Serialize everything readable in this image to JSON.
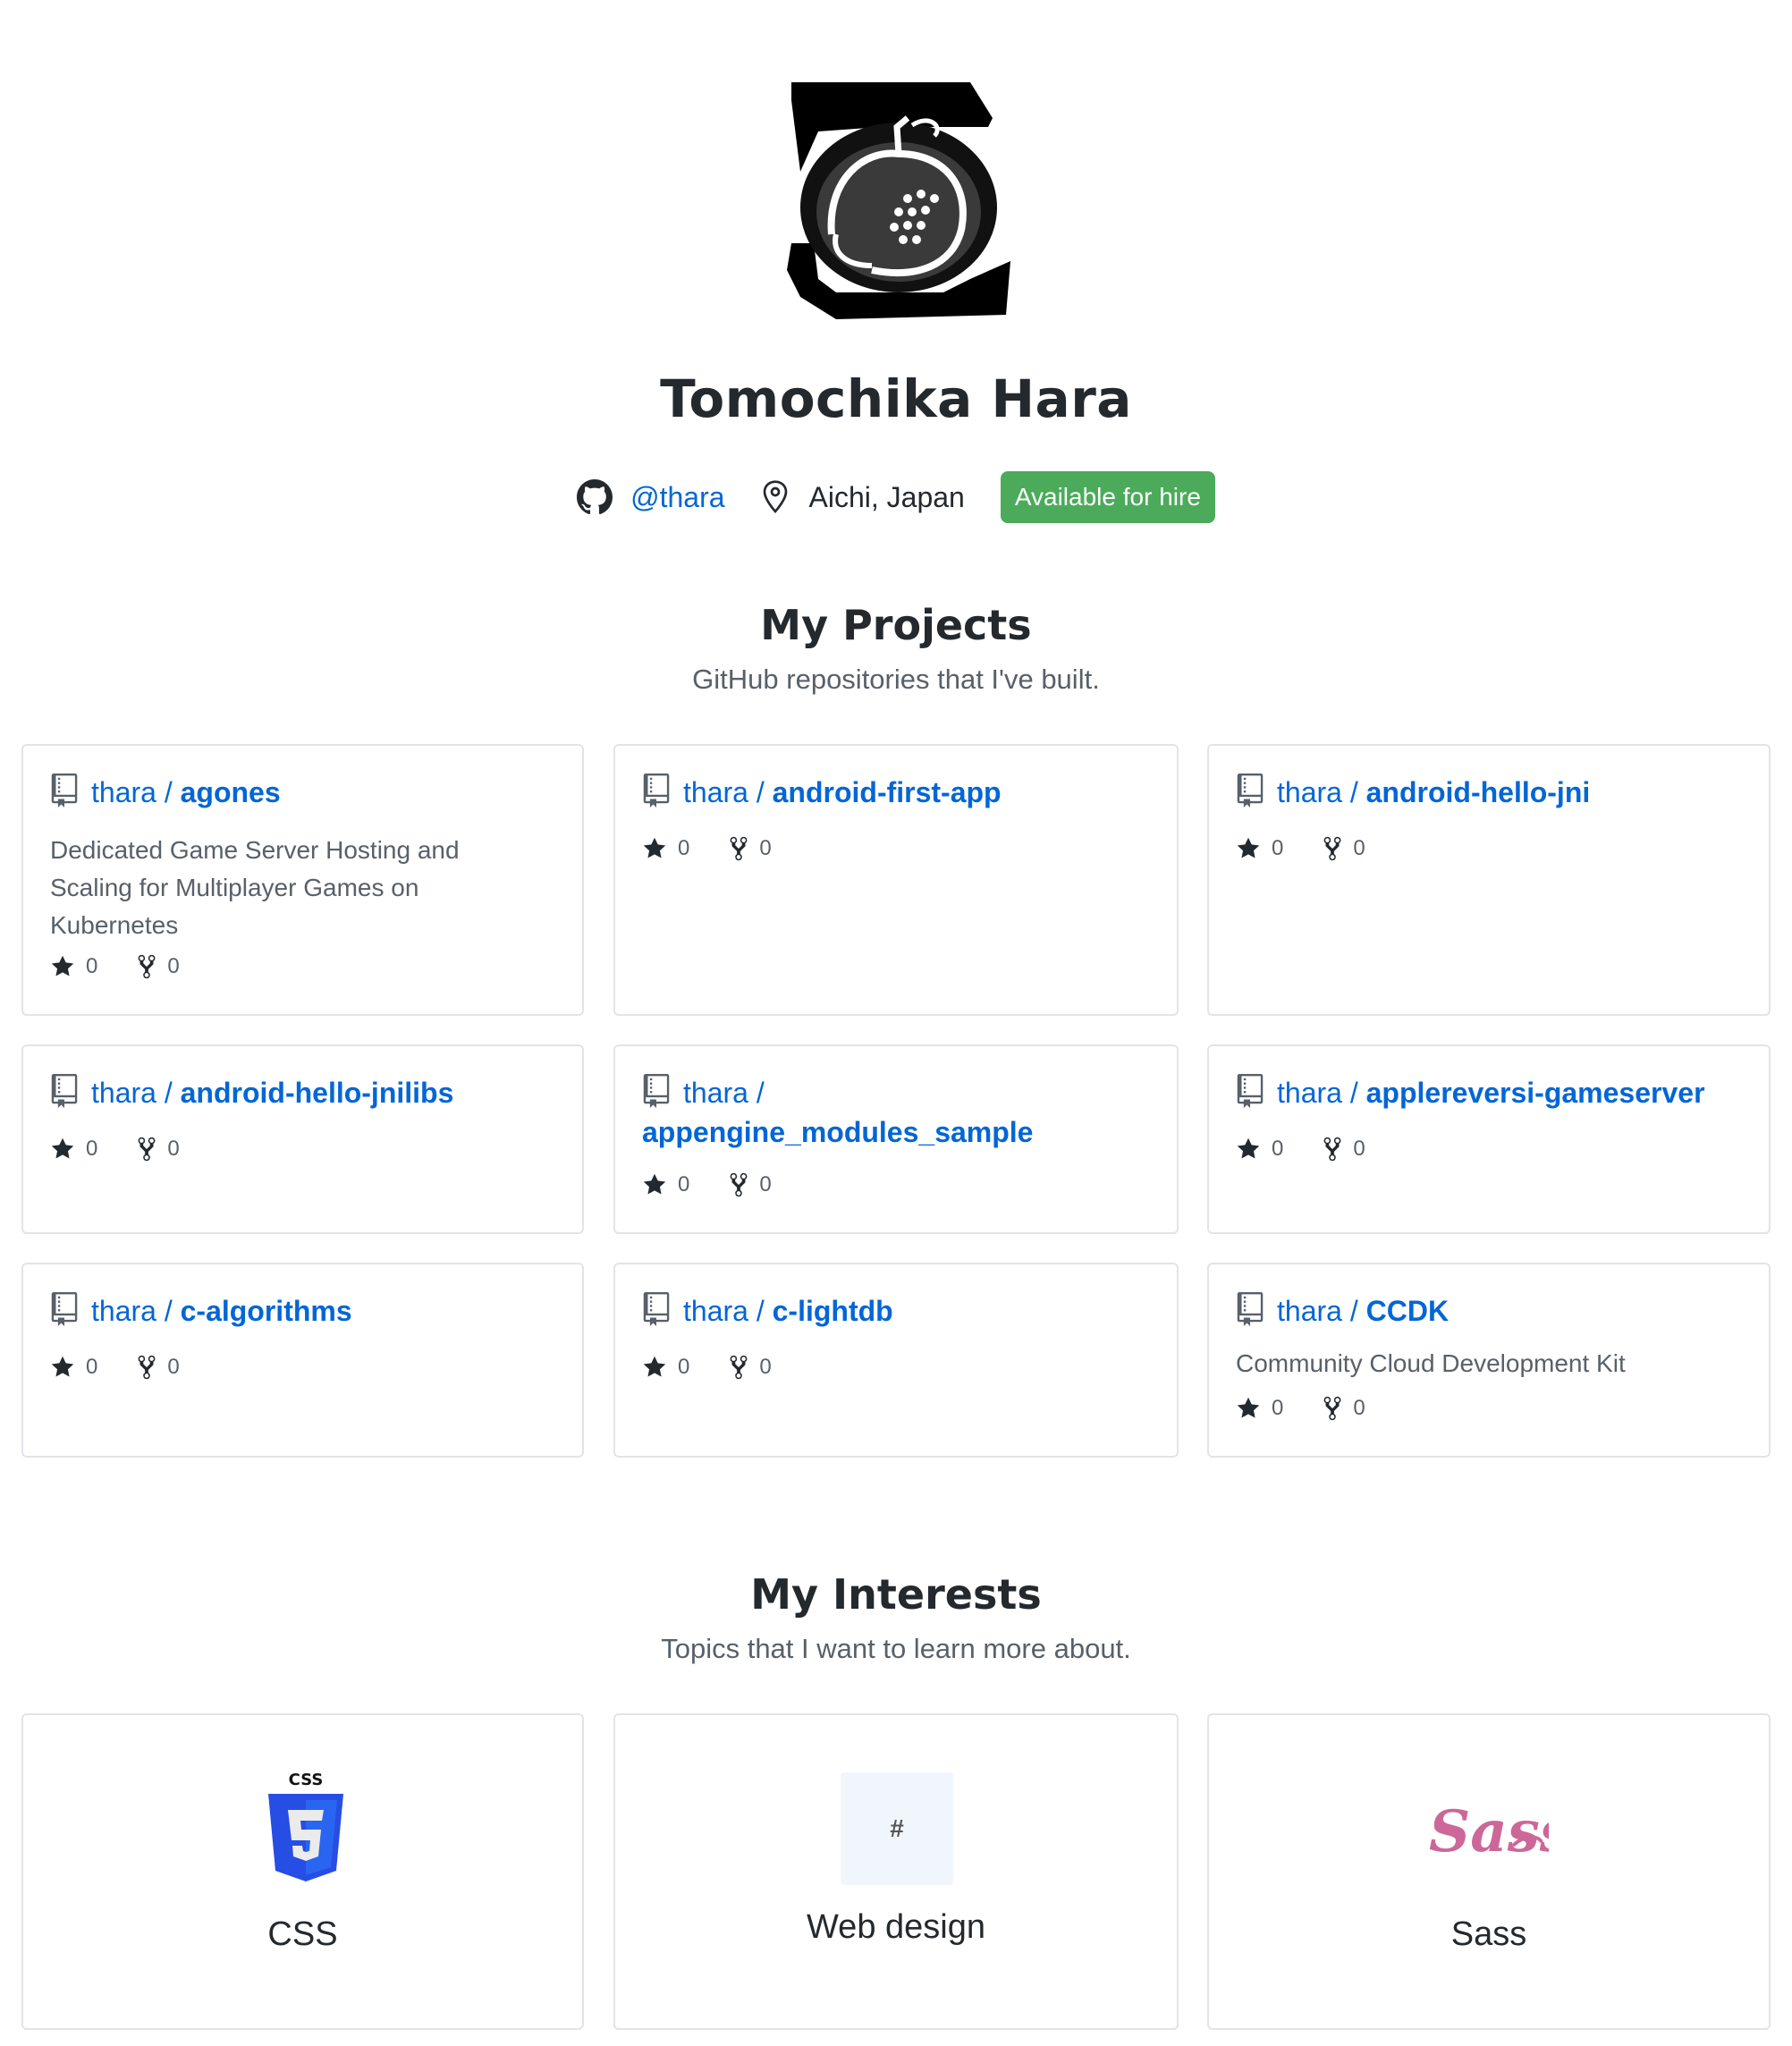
{
  "profile": {
    "name": "Tomochika Hara",
    "handle": "@thara",
    "location": "Aichi, Japan",
    "hire_badge": "Available for hire"
  },
  "projects": {
    "title": "My Projects",
    "subtitle": "GitHub repositories that I've built.",
    "items": [
      {
        "owner": "thara /",
        "repo": "agones",
        "description": "Dedicated Game Server Hosting and Scaling for Multiplayer Games on Kubernetes",
        "stars": "0",
        "forks": "0"
      },
      {
        "owner": "thara /",
        "repo": "android-first-app",
        "description": "",
        "stars": "0",
        "forks": "0"
      },
      {
        "owner": "thara /",
        "repo": "android-hello-jni",
        "description": "",
        "stars": "0",
        "forks": "0"
      },
      {
        "owner": "thara /",
        "repo": "android-hello-jnilibs",
        "description": "",
        "stars": "0",
        "forks": "0"
      },
      {
        "owner": "thara /",
        "repo": "appengine_modules_sample",
        "description": "",
        "stars": "0",
        "forks": "0"
      },
      {
        "owner": "thara /",
        "repo": "applereversi-gameserver",
        "description": "",
        "stars": "0",
        "forks": "0"
      },
      {
        "owner": "thara /",
        "repo": "c-algorithms",
        "description": "",
        "stars": "0",
        "forks": "0"
      },
      {
        "owner": "thara /",
        "repo": "c-lightdb",
        "description": "",
        "stars": "0",
        "forks": "0"
      },
      {
        "owner": "thara /",
        "repo": "CCDK",
        "description": "Community Cloud Development Kit",
        "stars": "0",
        "forks": "0"
      }
    ]
  },
  "interests": {
    "title": "My Interests",
    "subtitle": "Topics that I want to learn more about.",
    "items": [
      {
        "label": "CSS",
        "icon": "css3-logo-icon",
        "logo_text": "CSS"
      },
      {
        "label": "Web design",
        "icon": "hash-icon",
        "logo_text": "#"
      },
      {
        "label": "Sass",
        "icon": "sass-logo-icon",
        "logo_text": "Sass"
      }
    ]
  },
  "colors": {
    "link": "#0366d6",
    "hire_green": "#4bab5a",
    "border": "#e1e4e8",
    "muted": "#586069",
    "sass_pink": "#cd6799",
    "css_blue": "#2965f1"
  }
}
